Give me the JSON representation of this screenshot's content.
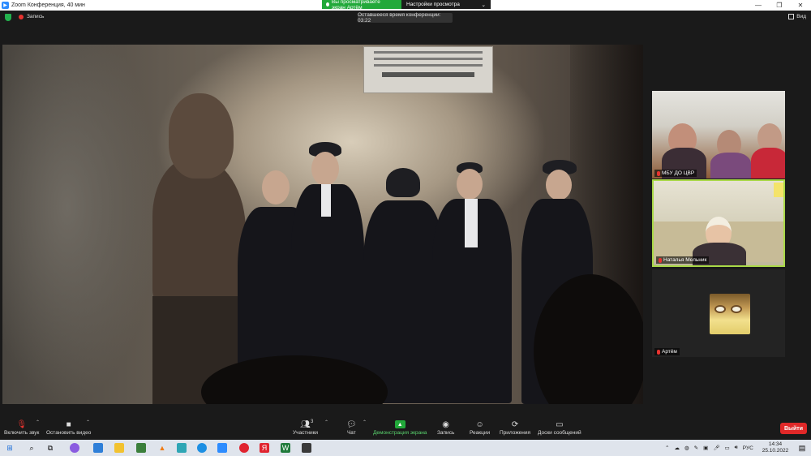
{
  "window": {
    "title": "Zoom Конференция, 40 мин",
    "controls": [
      "—",
      "❐",
      "✕"
    ]
  },
  "share_banner": {
    "viewing": "Вы просматриваете экран Артём",
    "options": "Настройки просмотра"
  },
  "topbar": {
    "recording": "Запись",
    "time_left": "Оставшееся время конференции: 03:22",
    "view": "Вид"
  },
  "participants": [
    {
      "name": "МБУ ДО ЦВР",
      "muted": true
    },
    {
      "name": "Наталья Мельник",
      "muted": true,
      "active_speaker": true
    },
    {
      "name": "Артём",
      "muted": true
    }
  ],
  "toolbar": {
    "mute": "Включить звук",
    "video": "Остановить видео",
    "participants": "Участники",
    "participants_count": "3",
    "chat": "Чат",
    "share": "Демонстрация экрана",
    "record": "Запись",
    "reactions": "Реакции",
    "apps": "Приложения",
    "whiteboards": "Доски сообщений",
    "leave": "Выйти"
  },
  "taskbar": {
    "lang": "РУС",
    "time": "14:34",
    "date": "25.10.2022"
  },
  "colors": {
    "share_green": "#22a93a",
    "leave_red": "#e02828",
    "active_border": "#a9d847",
    "muted_red": "#e8332f"
  }
}
